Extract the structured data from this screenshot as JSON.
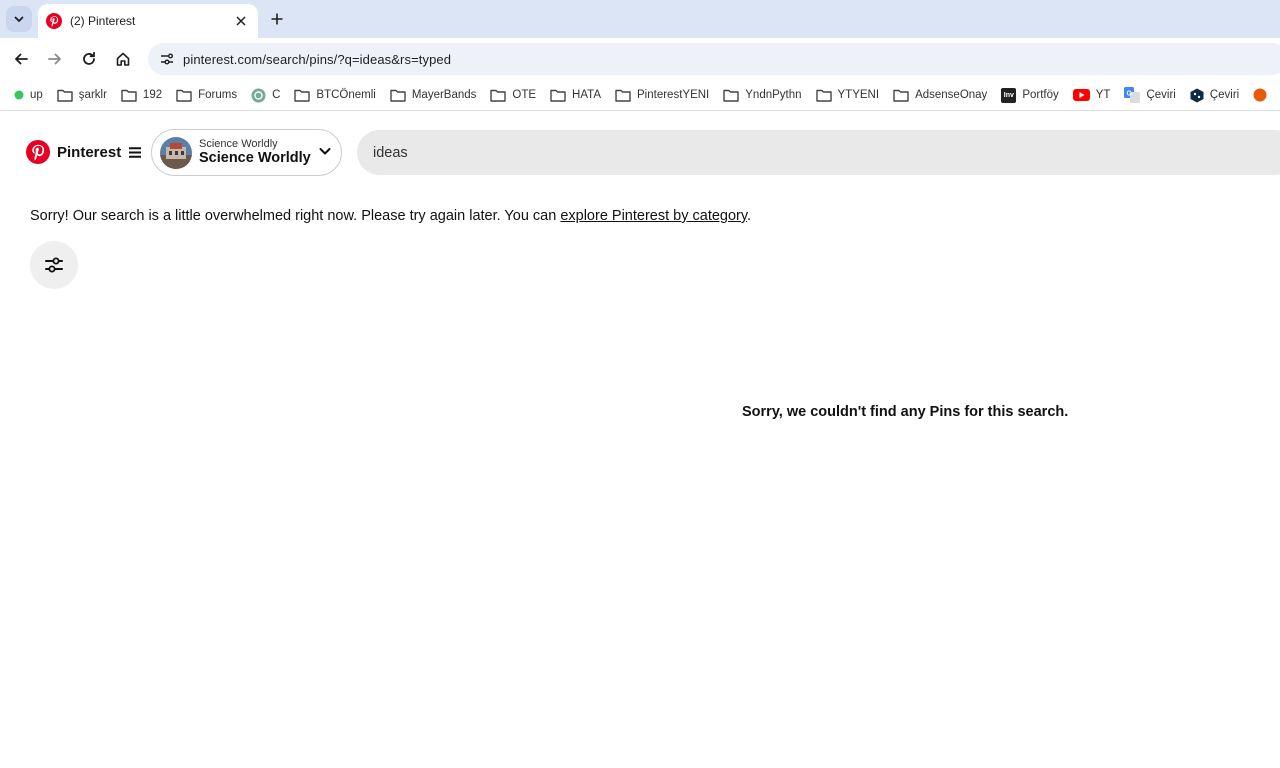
{
  "browser": {
    "tab": {
      "title": "(2) Pinterest"
    },
    "url": "pinterest.com/search/pins/?q=ideas&rs=typed",
    "bookmarks": [
      {
        "label": "up",
        "icon": "green-dot-icon"
      },
      {
        "label": "şarklr",
        "icon": "folder-icon"
      },
      {
        "label": "192",
        "icon": "folder-icon"
      },
      {
        "label": "Forums",
        "icon": "folder-icon"
      },
      {
        "label": "C",
        "icon": "chatgpt-icon"
      },
      {
        "label": "BTCÖnemli",
        "icon": "folder-icon"
      },
      {
        "label": "MayerBands",
        "icon": "folder-icon"
      },
      {
        "label": "OTE",
        "icon": "folder-icon"
      },
      {
        "label": "HATA",
        "icon": "folder-icon"
      },
      {
        "label": "PinterestYENI",
        "icon": "folder-icon"
      },
      {
        "label": "YndnPythn",
        "icon": "folder-icon"
      },
      {
        "label": "YTYENI",
        "icon": "folder-icon"
      },
      {
        "label": "AdsenseOnay",
        "icon": "folder-icon"
      },
      {
        "label": "Portföy",
        "icon": "investing-icon"
      },
      {
        "label": "YT",
        "icon": "youtube-icon"
      },
      {
        "label": "Çeviri",
        "icon": "google-translate-icon"
      },
      {
        "label": "Çeviri",
        "icon": "deepl-icon"
      }
    ],
    "icon_text": {
      "investing": "Inv"
    }
  },
  "pinterest": {
    "brand": "Pinterest",
    "account": {
      "small_name": "Science Worldly",
      "big_name": "Science Worldly"
    },
    "search": {
      "value": "ideas"
    }
  },
  "content": {
    "notice_prefix": "Sorry! Our search is a little overwhelmed right now. Please try again later. You can ",
    "notice_link": "explore Pinterest by category",
    "notice_suffix": ".",
    "empty_message": "Sorry, we couldn't find any Pins for this search."
  },
  "colors": {
    "pinterest_red": "#e60023",
    "tabstrip": "#dce5f5",
    "search_bg": "#e9e9e9"
  }
}
